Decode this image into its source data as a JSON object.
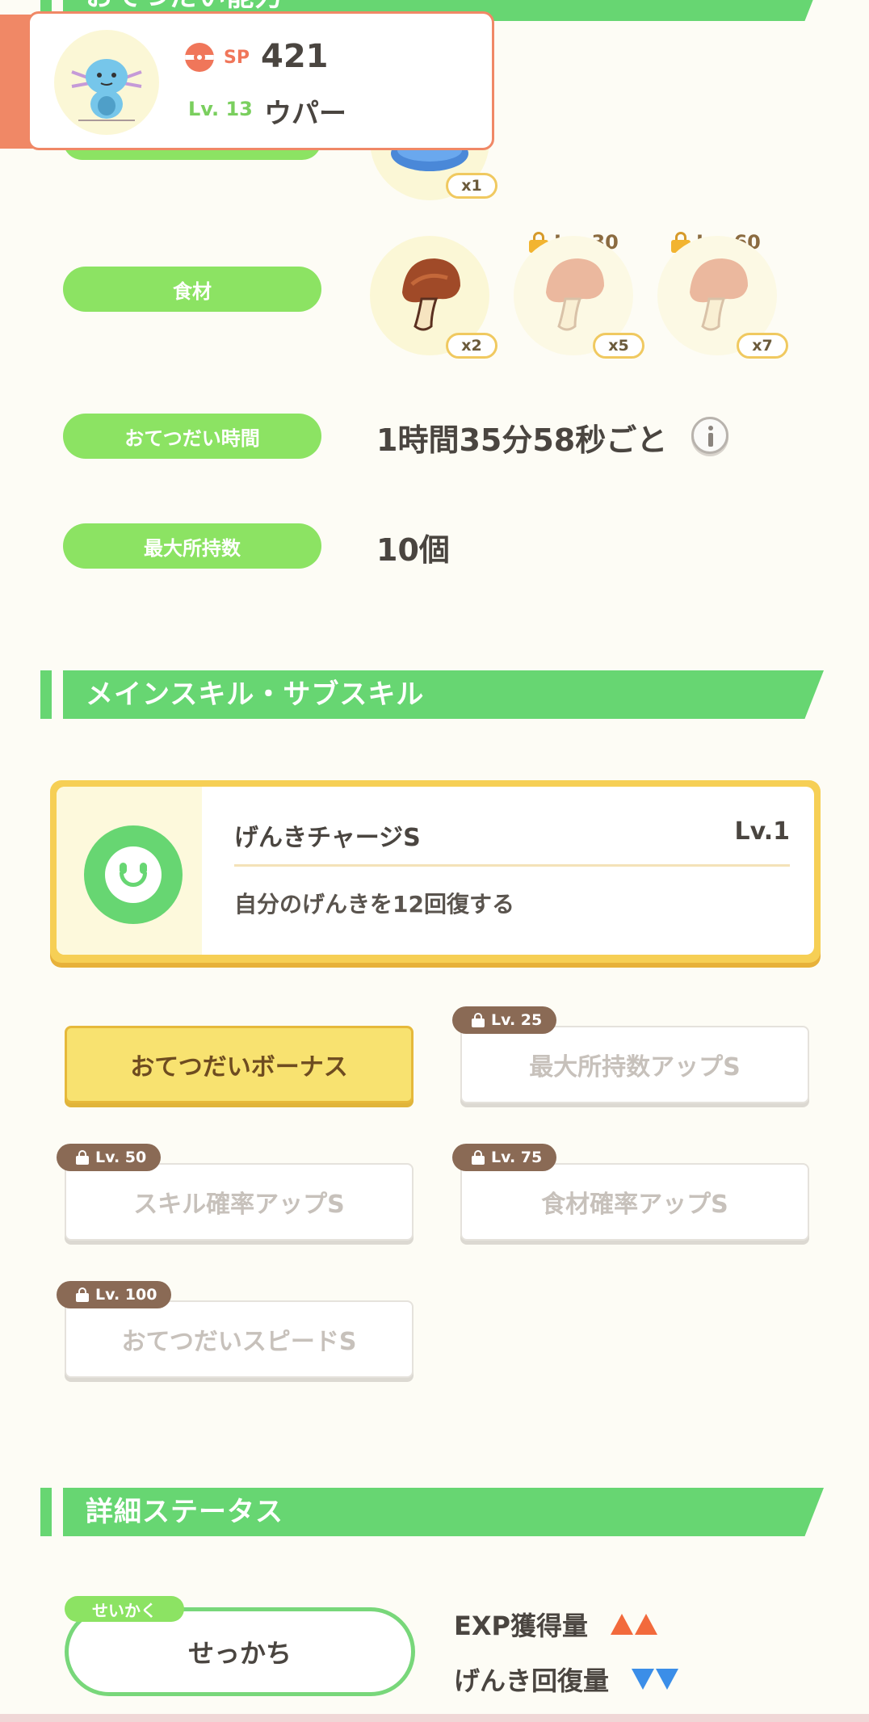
{
  "top_section": {
    "title": "おてつだい能力"
  },
  "pokemon_card": {
    "sp_label": "SP",
    "sp_value": "421",
    "level": "Lv. 13",
    "name": "ウパー"
  },
  "berry": {
    "count": "x1"
  },
  "ingredients": {
    "label": "食材",
    "items": [
      {
        "count": "x2",
        "lock_level": ""
      },
      {
        "count": "x5",
        "lock_level": "Lv. 30"
      },
      {
        "count": "x7",
        "lock_level": "Lv. 60"
      }
    ]
  },
  "help_time": {
    "label": "おてつだい時間",
    "value": "1時間35分58秒ごと"
  },
  "max_carry": {
    "label": "最大所持数",
    "value": "10個"
  },
  "skills_section": {
    "title": "メインスキル・サブスキル"
  },
  "main_skill": {
    "name": "げんきチャージS",
    "level": "Lv.1",
    "description": "自分のげんきを12回復する"
  },
  "sub_skills": [
    {
      "label": "おてつだいボーナス",
      "lock_level": "",
      "active": true
    },
    {
      "label": "最大所持数アップS",
      "lock_level": "Lv. 25",
      "active": false
    },
    {
      "label": "スキル確率アップS",
      "lock_level": "Lv. 50",
      "active": false
    },
    {
      "label": "食材確率アップS",
      "lock_level": "Lv. 75",
      "active": false
    },
    {
      "label": "おてつだいスピードS",
      "lock_level": "Lv. 100",
      "active": false
    }
  ],
  "detail_section": {
    "title": "詳細ステータス"
  },
  "nature": {
    "tag": "せいかく",
    "value": "せっかち",
    "effects": [
      {
        "label": "EXP獲得量",
        "direction": "up"
      },
      {
        "label": "げんき回復量",
        "direction": "down"
      }
    ]
  },
  "colors": {
    "green": "#67d672",
    "pill_green": "#8ce363",
    "accent_orange": "#f08866",
    "gold": "#f6cf55",
    "up_arrow": "#f26a3c",
    "down_arrow": "#3b8ee8"
  }
}
